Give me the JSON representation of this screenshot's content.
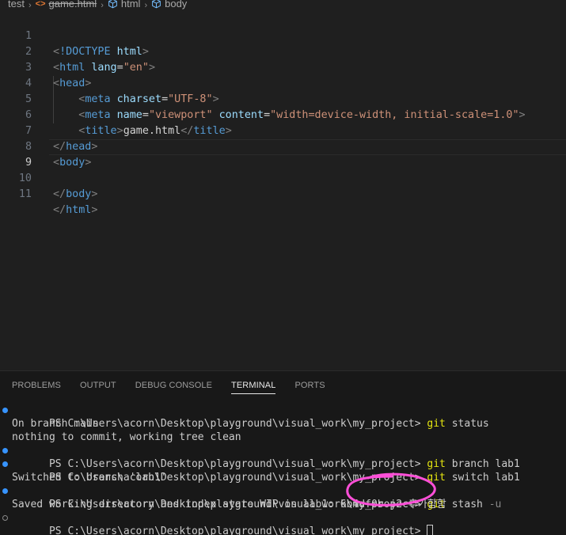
{
  "breadcrumb": {
    "folder": "test",
    "file": "game.html",
    "element1": "html",
    "element2": "body"
  },
  "editor": {
    "lines": [
      {
        "n": "1"
      },
      {
        "n": "2"
      },
      {
        "n": "3"
      },
      {
        "n": "4"
      },
      {
        "n": "5"
      },
      {
        "n": "6"
      },
      {
        "n": "7"
      },
      {
        "n": "8"
      },
      {
        "n": "9"
      },
      {
        "n": "10"
      },
      {
        "n": "11"
      }
    ],
    "code": {
      "doctype_kw": "!DOCTYPE",
      "doctype_val": "html",
      "html_tag": "html",
      "lang_attr": "lang",
      "lang_val": "\"en\"",
      "head_tag": "head",
      "meta_tag": "meta",
      "charset_attr": "charset",
      "charset_val": "\"UTF-8\"",
      "name_attr": "name",
      "name_val": "\"viewport\"",
      "content_attr": "content",
      "content_val": "\"width=device-width, initial-scale=1.0\"",
      "title_tag": "title",
      "title_text": "game.html",
      "body_tag": "body"
    }
  },
  "panel": {
    "tabs": [
      {
        "label": "PROBLEMS"
      },
      {
        "label": "OUTPUT"
      },
      {
        "label": "DEBUG CONSOLE"
      },
      {
        "label": "TERMINAL"
      },
      {
        "label": "PORTS"
      }
    ],
    "active_tab": "TERMINAL"
  },
  "terminal": {
    "prompt": "PS C:\\Users\\acorn\\Desktop\\playground\\visual_work\\my_project> ",
    "cmd1": "git",
    "cmd1_args": "status",
    "out1a": "On branch main",
    "out1b": "nothing to commit, working tree clean",
    "cmd2": "git",
    "cmd2_args": "branch lab1",
    "cmd3": "git",
    "cmd3_args": "switch lab1",
    "out3": "Switched to branch 'lab1'",
    "cmd4": "git",
    "cmd4_args": "stash",
    "cmd4_flag": "-u",
    "out4": "Saved working directory and index state WIP on lab1: 6b4df0b p2 추가함함"
  },
  "colors": {
    "accent_dot": "#3794ff",
    "annotation": "#ff4fd8"
  }
}
